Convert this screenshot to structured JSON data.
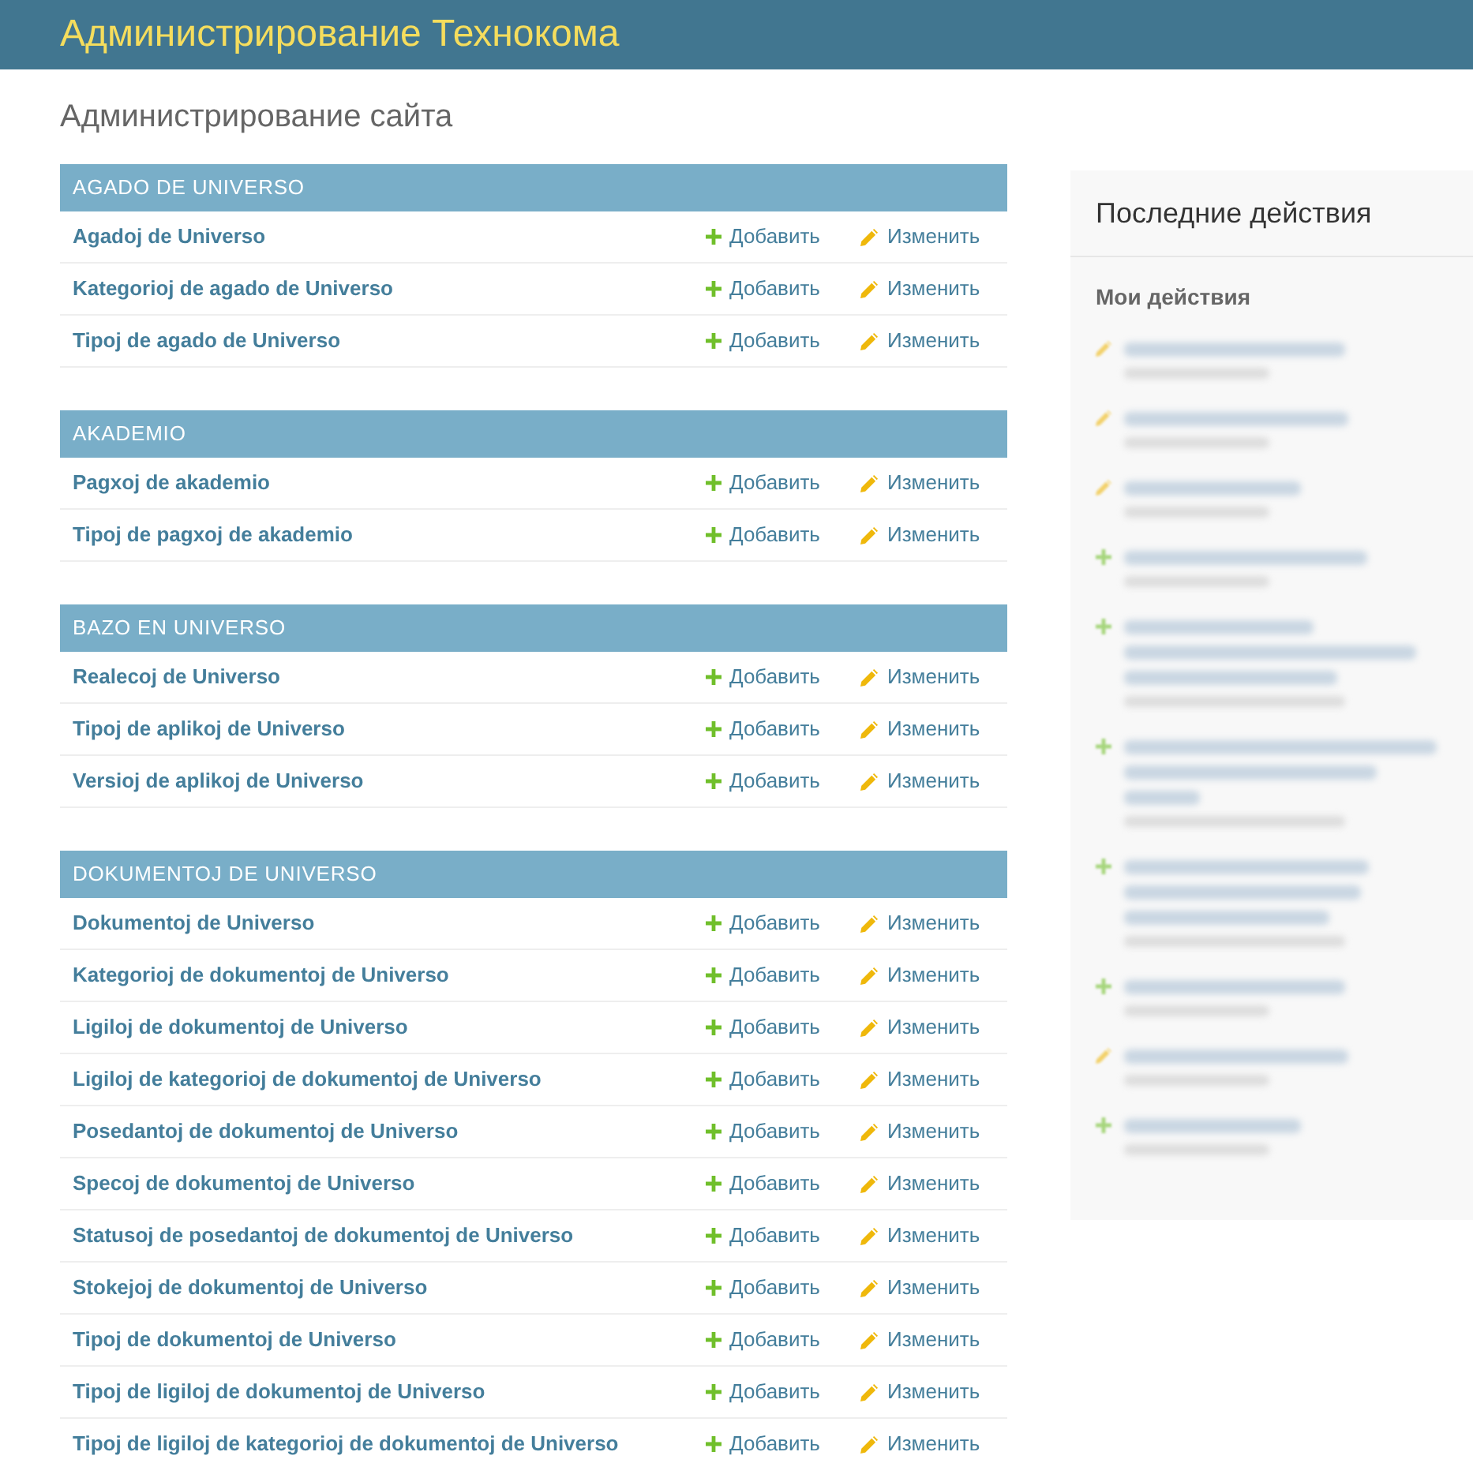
{
  "header": {
    "title": "Администрирование Технокома"
  },
  "page_title": "Администрирование сайта",
  "modules": [
    {
      "caption": "AGADO DE UNIVERSO",
      "models": [
        {
          "name": "Agadoj de Universo",
          "add_label": "Добавить",
          "change_label": "Изменить"
        },
        {
          "name": "Kategorioj de agado de Universo",
          "add_label": "Добавить",
          "change_label": "Изменить"
        },
        {
          "name": "Tipoj de agado de Universo",
          "add_label": "Добавить",
          "change_label": "Изменить"
        }
      ]
    },
    {
      "caption": "AKADEMIO",
      "models": [
        {
          "name": "Pagxoj de akademio",
          "add_label": "Добавить",
          "change_label": "Изменить"
        },
        {
          "name": "Tipoj de pagxoj de akademio",
          "add_label": "Добавить",
          "change_label": "Изменить"
        }
      ]
    },
    {
      "caption": "BAZO EN UNIVERSO",
      "models": [
        {
          "name": "Realecoj de Universo",
          "add_label": "Добавить",
          "change_label": "Изменить"
        },
        {
          "name": "Tipoj de aplikoj de Universo",
          "add_label": "Добавить",
          "change_label": "Изменить"
        },
        {
          "name": "Versioj de aplikoj de Universo",
          "add_label": "Добавить",
          "change_label": "Изменить"
        }
      ]
    },
    {
      "caption": "DOKUMENTOJ DE UNIVERSO",
      "models": [
        {
          "name": "Dokumentoj de Universo",
          "add_label": "Добавить",
          "change_label": "Изменить"
        },
        {
          "name": "Kategorioj de dokumentoj de Universo",
          "add_label": "Добавить",
          "change_label": "Изменить"
        },
        {
          "name": "Ligiloj de dokumentoj de Universo",
          "add_label": "Добавить",
          "change_label": "Изменить"
        },
        {
          "name": "Ligiloj de kategorioj de dokumentoj de Universo",
          "add_label": "Добавить",
          "change_label": "Изменить"
        },
        {
          "name": "Posedantoj de dokumentoj de Universo",
          "add_label": "Добавить",
          "change_label": "Изменить"
        },
        {
          "name": "Specoj de dokumentoj de Universo",
          "add_label": "Добавить",
          "change_label": "Изменить"
        },
        {
          "name": "Statusoj de posedantoj de dokumentoj de Universo",
          "add_label": "Добавить",
          "change_label": "Изменить"
        },
        {
          "name": "Stokejoj de dokumentoj de Universo",
          "add_label": "Добавить",
          "change_label": "Изменить"
        },
        {
          "name": "Tipoj de dokumentoj de Universo",
          "add_label": "Добавить",
          "change_label": "Изменить"
        },
        {
          "name": "Tipoj de ligiloj de dokumentoj de Universo",
          "add_label": "Добавить",
          "change_label": "Изменить"
        },
        {
          "name": "Tipoj de ligiloj de kategorioj de dokumentoj de Universo",
          "add_label": "Добавить",
          "change_label": "Изменить"
        }
      ]
    }
  ],
  "sidebar": {
    "title": "Последние действия",
    "subtitle": "Мои действия",
    "actions": [
      {
        "kind": "change",
        "wrapped": false
      },
      {
        "kind": "change",
        "wrapped": false
      },
      {
        "kind": "change",
        "wrapped": false
      },
      {
        "kind": "addition",
        "wrapped": false
      },
      {
        "kind": "addition",
        "wrapped": true
      },
      {
        "kind": "addition",
        "wrapped": true
      },
      {
        "kind": "addition",
        "wrapped": true
      },
      {
        "kind": "addition",
        "wrapped": false
      },
      {
        "kind": "change",
        "wrapped": false
      },
      {
        "kind": "addition",
        "wrapped": false
      }
    ]
  }
}
